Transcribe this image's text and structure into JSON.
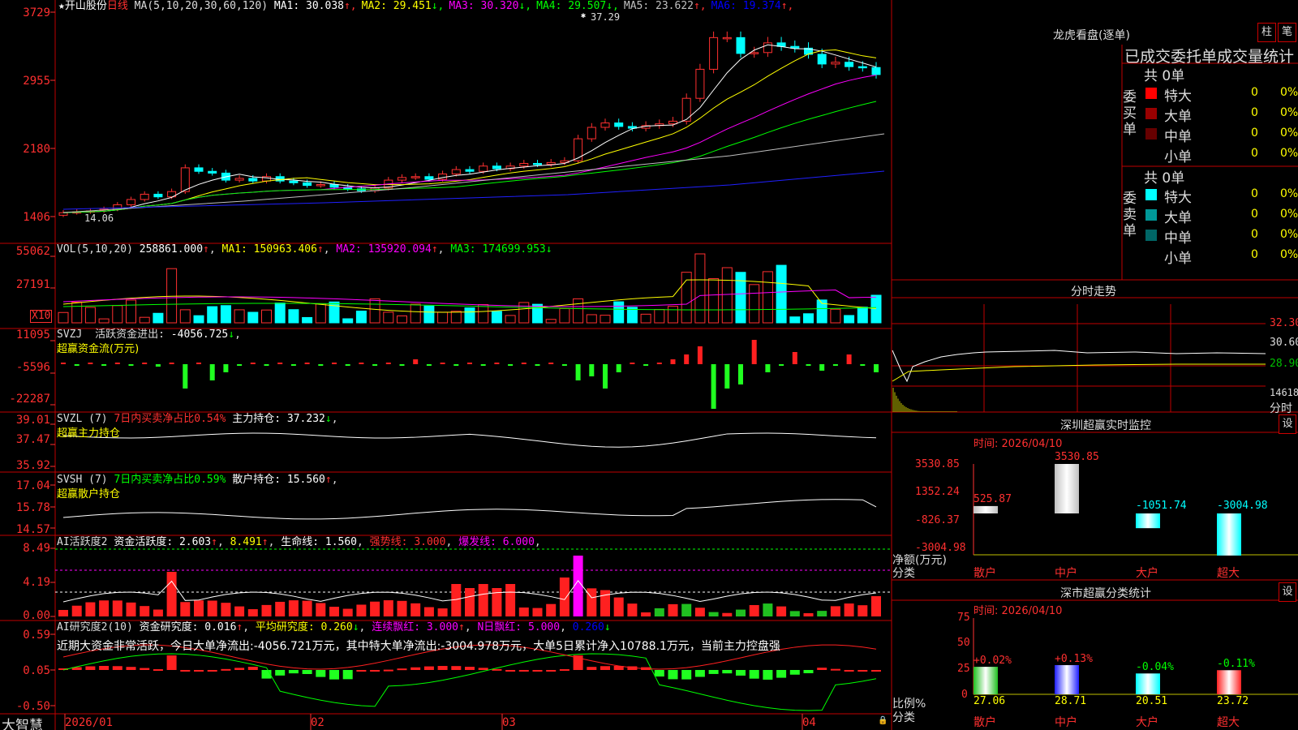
{
  "main": {
    "stock_name": "★开山股份",
    "period": "日线",
    "ma_params": "MA(5,10,20,30,60,120)",
    "ma_values": [
      {
        "name": "MA1:",
        "value": "30.038",
        "arrow": "↑",
        "color": "#ffffff"
      },
      {
        "name": "MA2:",
        "value": "29.451",
        "arrow": "↓",
        "color": "#ffff00"
      },
      {
        "name": "MA3:",
        "value": "30.320",
        "arrow": "↓",
        "color": "#ff00ff"
      },
      {
        "name": "MA4:",
        "value": "29.507",
        "arrow": "↓",
        "color": "#00ff00"
      },
      {
        "name": "MA5:",
        "value": "23.622",
        "arrow": "↑",
        "color": "#c0c0c0"
      },
      {
        "name": "MA6:",
        "value": "19.374",
        "arrow": "↑",
        "color": "#0000ff"
      }
    ],
    "y_ticks": [
      "3729",
      "2955",
      "2180",
      "1406"
    ],
    "high_label": "37.29",
    "low_label": "14.06"
  },
  "vol": {
    "title": "VOL(5,10,20)",
    "value": "258861.000",
    "ma1": "150963.406",
    "ma2": "135920.094",
    "ma3": "174699.953",
    "y_ticks": [
      "55062",
      "27191"
    ],
    "unit": "X10"
  },
  "svzj": {
    "title": "SVZJ",
    "desc": "活跃资金进出:",
    "value": "-4056.725",
    "subtitle": "超赢资金流(万元)",
    "y_ticks": [
      "11095",
      "-5596",
      "-22287"
    ]
  },
  "svzl": {
    "title": "SVZL (7)",
    "desc": "7日内买卖净占比0.54%",
    "label": "主力持仓:",
    "value": "37.232",
    "subtitle": "超赢主力持仓",
    "y_ticks": [
      "39.01",
      "37.47",
      "35.92"
    ]
  },
  "svsh": {
    "title": "SVSH (7)",
    "desc": "7日内买卖净占比0.59%",
    "label": "散户持仓:",
    "value": "15.560",
    "subtitle": "超赢散户持仓",
    "y_ticks": [
      "17.04",
      "15.78",
      "14.57"
    ]
  },
  "ai1": {
    "title": "AI活跃度2",
    "label": "资金活跃度:",
    "value": "2.603",
    "v2": "8.491",
    "life_label": "生命线:",
    "life": "1.560",
    "strong": "强势线: 3.000",
    "burst": "爆发线: 6.000",
    "y_ticks": [
      "8.49",
      "4.19",
      "0.00"
    ]
  },
  "ai2": {
    "title": "AI研究度2(10)",
    "label": "资金研究度:",
    "value": "0.016",
    "avg": "平均研究度: 0.260",
    "cont": "连续飘红: 3.000",
    "n": "N日飘红: 5.000",
    "last": "0.260",
    "note": "近期大资金非常活跃，今日大单净流出:-4056.721万元，其中特大单净流出:-3004.978万元，大单5日累计净入10788.1万元，当前主力控盘强",
    "y_ticks": [
      "0.59",
      "0.05",
      "-0.50"
    ]
  },
  "xaxis": {
    "brand": "大智慧",
    "labels": [
      "2026/01",
      "02",
      "03",
      "04"
    ]
  },
  "right": {
    "dragon_title": "龙虎看盘(逐单)",
    "btn1": "柱",
    "btn2": "笔",
    "tabs_text": "已成交委托单成交量统计",
    "buy_label": "委买单",
    "sell_label": "委卖单",
    "buy_total": "共 0单",
    "sell_total": "共 0单",
    "buy_rows": [
      {
        "name": "特大",
        "count": "0",
        "pct": "0%",
        "color": "#ff0000"
      },
      {
        "name": "大单",
        "count": "0",
        "pct": "0%",
        "color": "#990000"
      },
      {
        "name": "中单",
        "count": "0",
        "pct": "0%",
        "color": "#660000"
      },
      {
        "name": "小单",
        "count": "0",
        "pct": "0%",
        "color": ""
      }
    ],
    "sell_rows": [
      {
        "name": "特大",
        "count": "0",
        "pct": "0%",
        "color": "#00ffff"
      },
      {
        "name": "大单",
        "count": "0",
        "pct": "0%",
        "color": "#009999"
      },
      {
        "name": "中单",
        "count": "0",
        "pct": "0%",
        "color": "#006666"
      },
      {
        "name": "小单",
        "count": "0",
        "pct": "0%",
        "color": ""
      }
    ],
    "intraday_title": "分时走势",
    "intraday_ticks": [
      "32.30",
      "30.60",
      "28.90",
      "14618",
      "分时"
    ],
    "monitor_title": "深圳超赢实时监控",
    "monitor_btn": "设",
    "monitor_time": "时间: 2026/04/10",
    "monitor_ticks": [
      "3530.85",
      "1352.24",
      "-826.37",
      "-3004.98"
    ],
    "monitor_axis_label1": "净额(万元)",
    "monitor_axis_label2": "分类",
    "monitor_bars": [
      {
        "cat": "散户",
        "value": 525.87,
        "label": "525.87"
      },
      {
        "cat": "中户",
        "value": 3530.85,
        "label": "3530.85"
      },
      {
        "cat": "大户",
        "value": -1051.74,
        "label": "-1051.74"
      },
      {
        "cat": "超大",
        "value": -3004.98,
        "label": "-3004.98"
      }
    ],
    "class_title": "深市超赢分类统计",
    "class_btn": "设",
    "class_time": "时间: 2026/04/10",
    "class_ticks": [
      "75",
      "50",
      "25",
      "0"
    ],
    "class_axis_label1": "比例%",
    "class_axis_label2": "分类",
    "class_bars": [
      {
        "cat": "散户",
        "value": 27.06,
        "label": "27.06",
        "delta": "+0.02%",
        "color": "#20c020"
      },
      {
        "cat": "中户",
        "value": 28.71,
        "label": "28.71",
        "delta": "+0.13%",
        "color": "#2020ff"
      },
      {
        "cat": "大户",
        "value": 20.51,
        "label": "20.51",
        "delta": "-0.04%",
        "color": "#00ffff"
      },
      {
        "cat": "超大",
        "value": 23.72,
        "label": "23.72",
        "delta": "-0.11%",
        "color": "#ff2020"
      }
    ]
  }
}
